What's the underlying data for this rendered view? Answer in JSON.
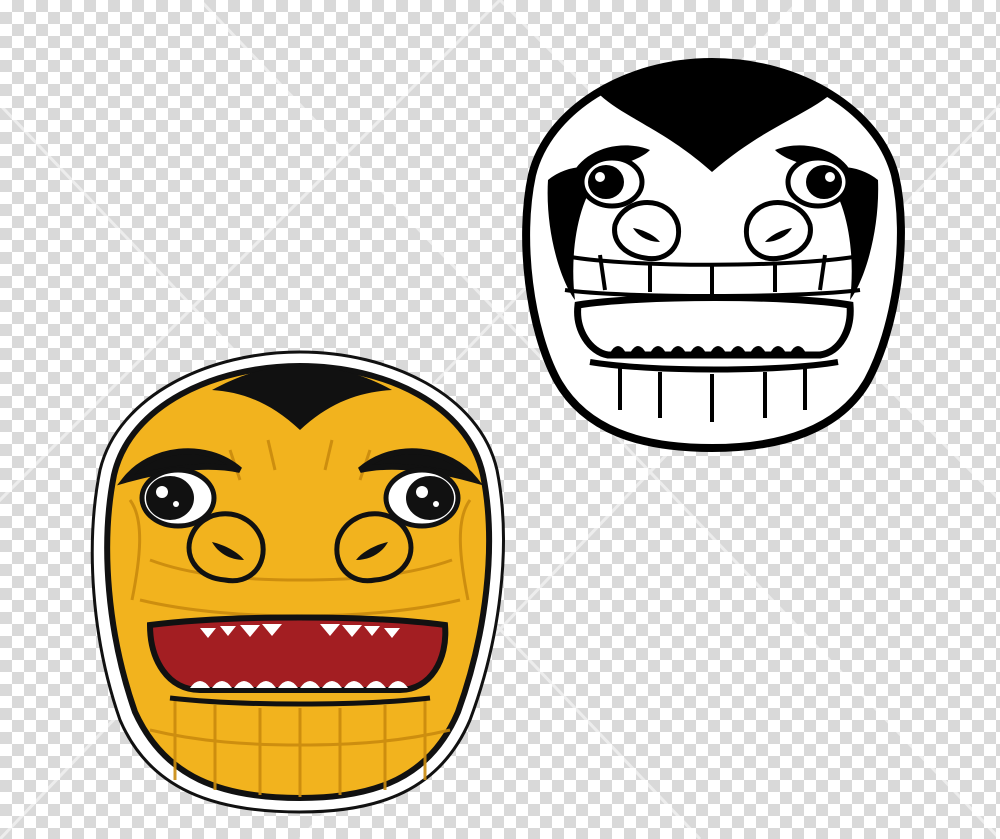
{
  "artwork": {
    "colored_mascot": {
      "icon": "dinosaur-head-colored",
      "colors": {
        "skin": "#f2b31e",
        "skin_shadow": "#d9930f",
        "outline": "#111111",
        "mouth": "#a31e22",
        "teeth": "#ffffff",
        "sticker_border": "#ffffff"
      }
    },
    "outline_mascot": {
      "icon": "dinosaur-head-outline",
      "colors": {
        "fill": "#ffffff",
        "outline": "#000000"
      }
    },
    "background": {
      "pattern": "transparency-checkerboard",
      "colors": {
        "light": "#ffffff",
        "dark": "#d9d9d9"
      }
    }
  }
}
